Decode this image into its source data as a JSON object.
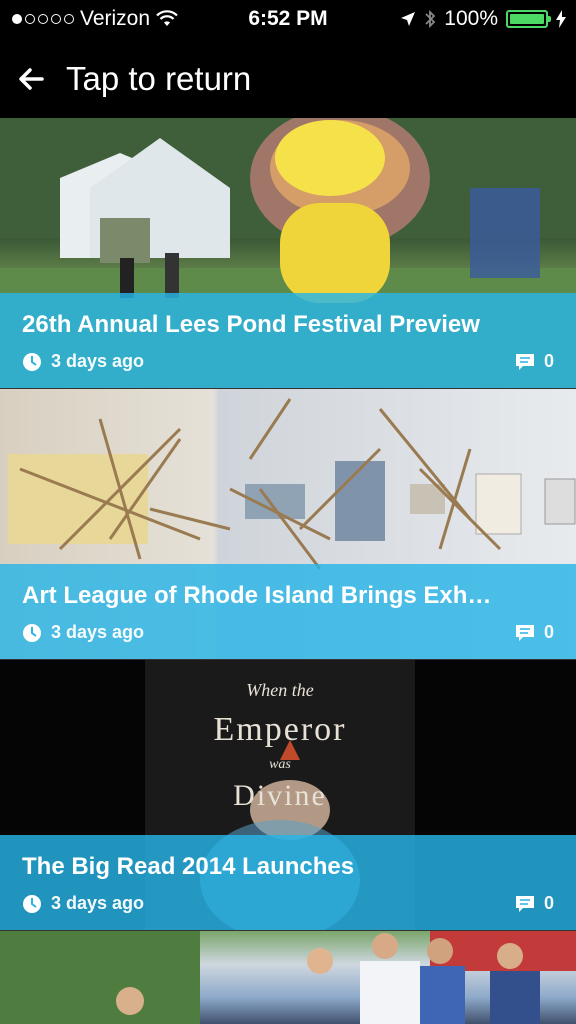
{
  "status_bar": {
    "carrier": "Verizon",
    "time": "6:52 PM",
    "battery": "100%"
  },
  "header": {
    "title": "Tap to return",
    "back_icon": "back-arrow-icon"
  },
  "articles": [
    {
      "title": "26th Annual Lees Pond Festival Preview",
      "time": "3 days ago",
      "comments": "0"
    },
    {
      "title": "Art League of Rhode Island Brings Exh…",
      "time": "3 days ago",
      "comments": "0"
    },
    {
      "title": "The Big Read 2014 Launches",
      "time": "3 days ago",
      "comments": "0"
    }
  ],
  "book_cover": {
    "line1": "When the",
    "line2": "Emperor",
    "line3": "was",
    "line4": "Divine"
  },
  "colors": {
    "overlay": "#28b4e6",
    "battery": "#4cd964"
  }
}
